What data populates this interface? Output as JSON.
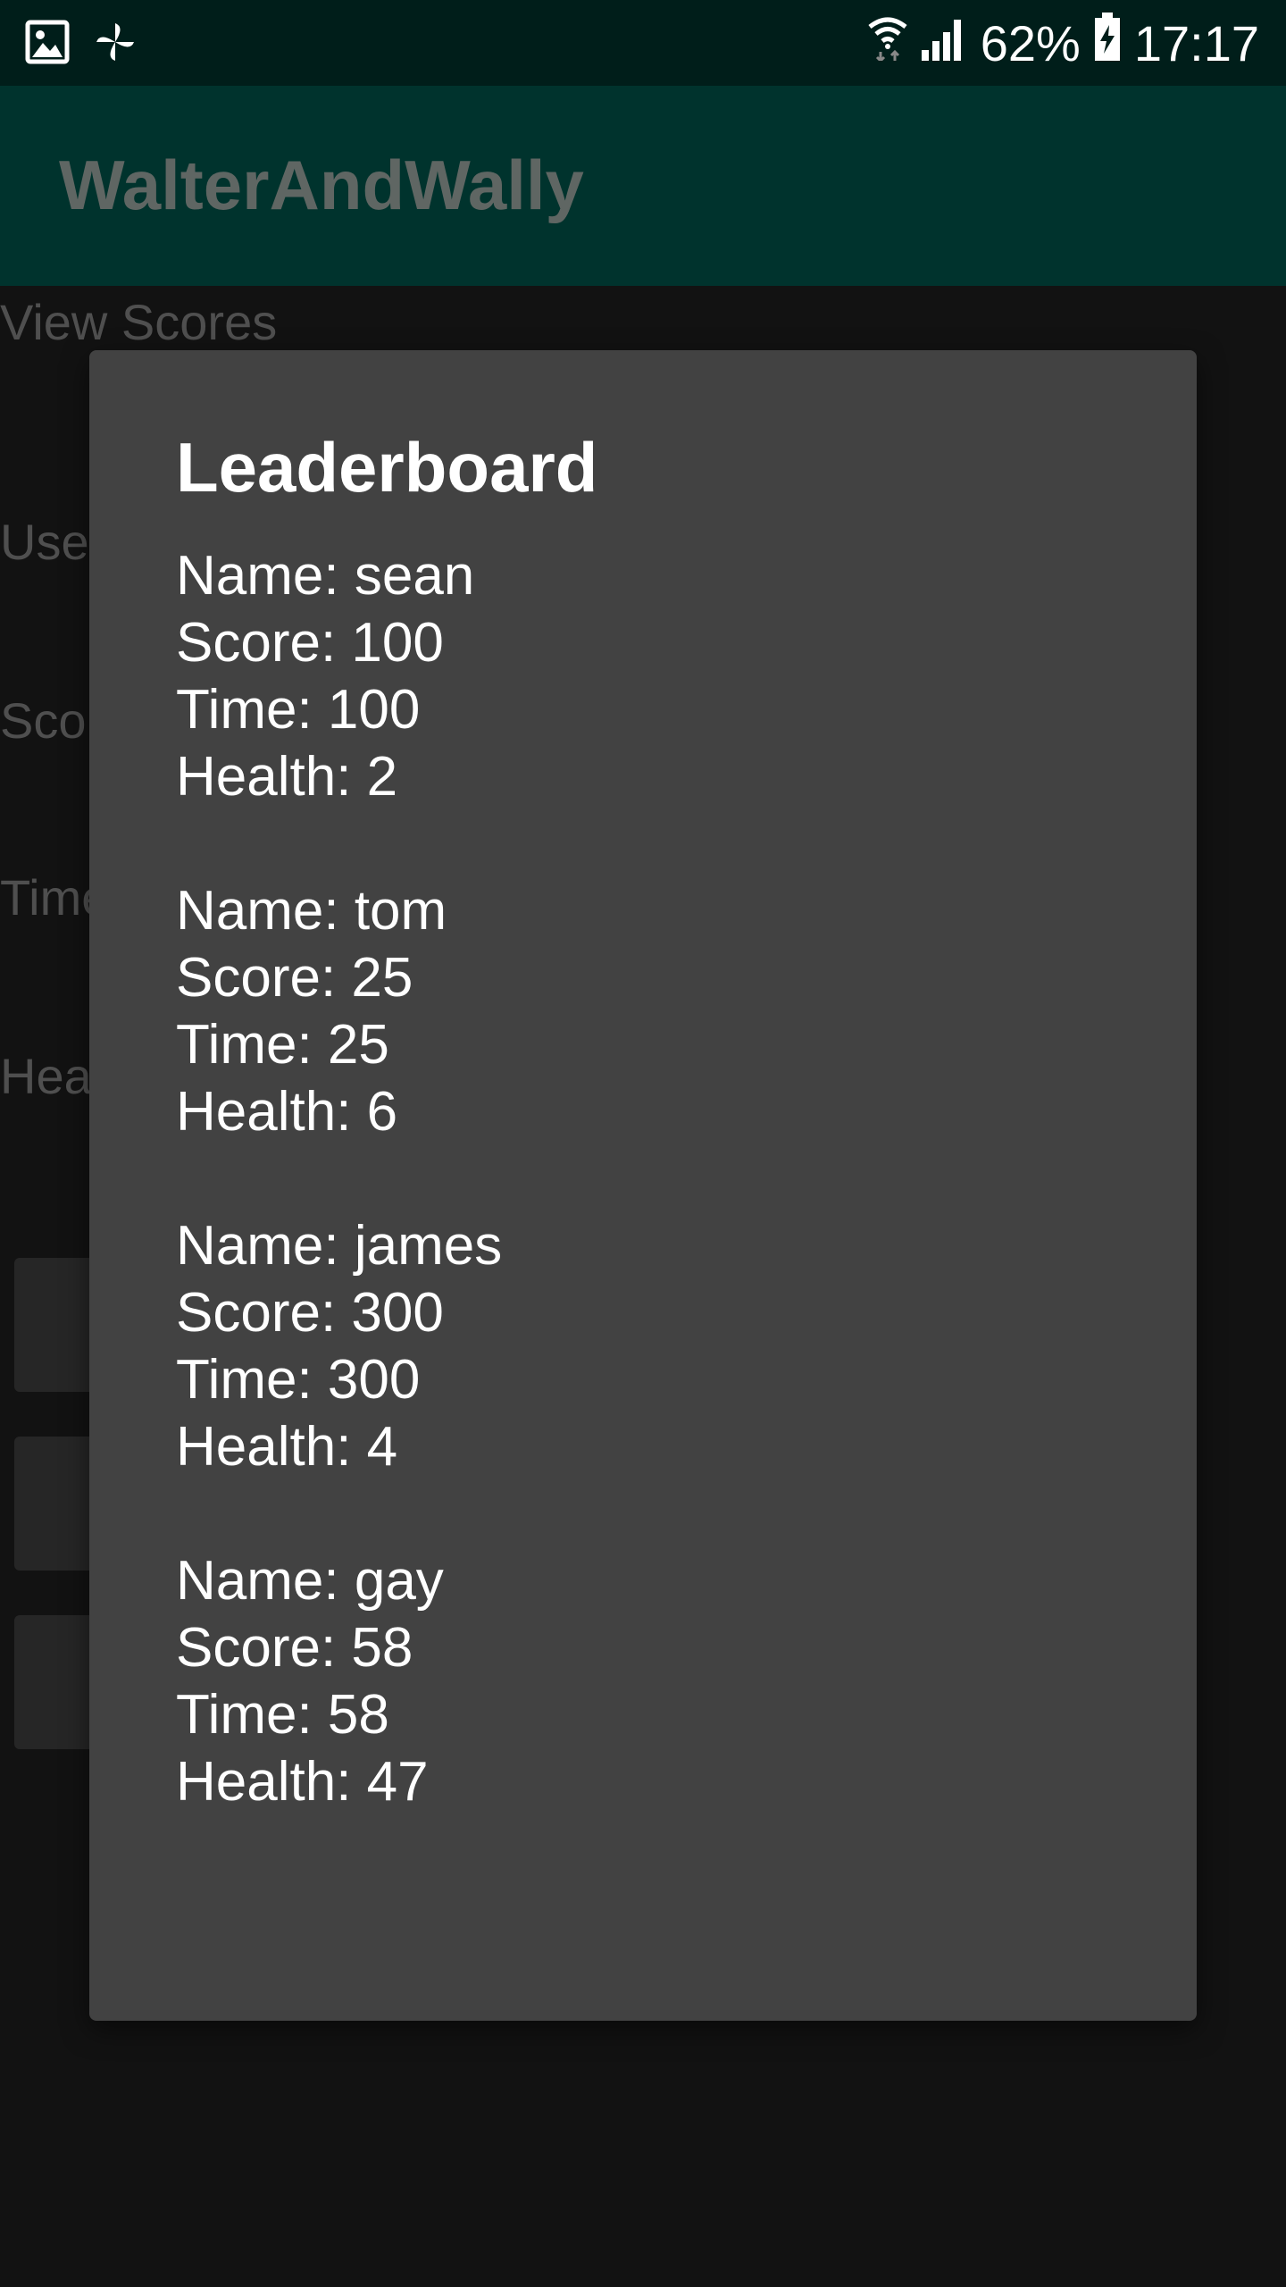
{
  "status_bar": {
    "battery": "62%",
    "time": "17:17",
    "icons": [
      "gallery-icon",
      "pinwheel-icon",
      "wifi-icon",
      "signal-icon",
      "battery-charging-icon"
    ]
  },
  "app_bar": {
    "title": "WalterAndWally"
  },
  "background": {
    "view_scores_label": "View Scores",
    "labels": [
      "User",
      "Scor",
      "Time",
      "Hea"
    ]
  },
  "dialog": {
    "title": "Leaderboard",
    "entries": [
      {
        "name": "Name: sean",
        "score": "Score: 100",
        "time": "Time: 100",
        "health": "Health: 2"
      },
      {
        "name": "Name: tom",
        "score": "Score: 25",
        "time": "Time: 25",
        "health": "Health: 6"
      },
      {
        "name": "Name: james",
        "score": "Score: 300",
        "time": "Time: 300",
        "health": "Health: 4"
      },
      {
        "name": "Name: gay",
        "score": "Score: 58",
        "time": "Time: 58",
        "health": "Health: 47"
      }
    ]
  }
}
